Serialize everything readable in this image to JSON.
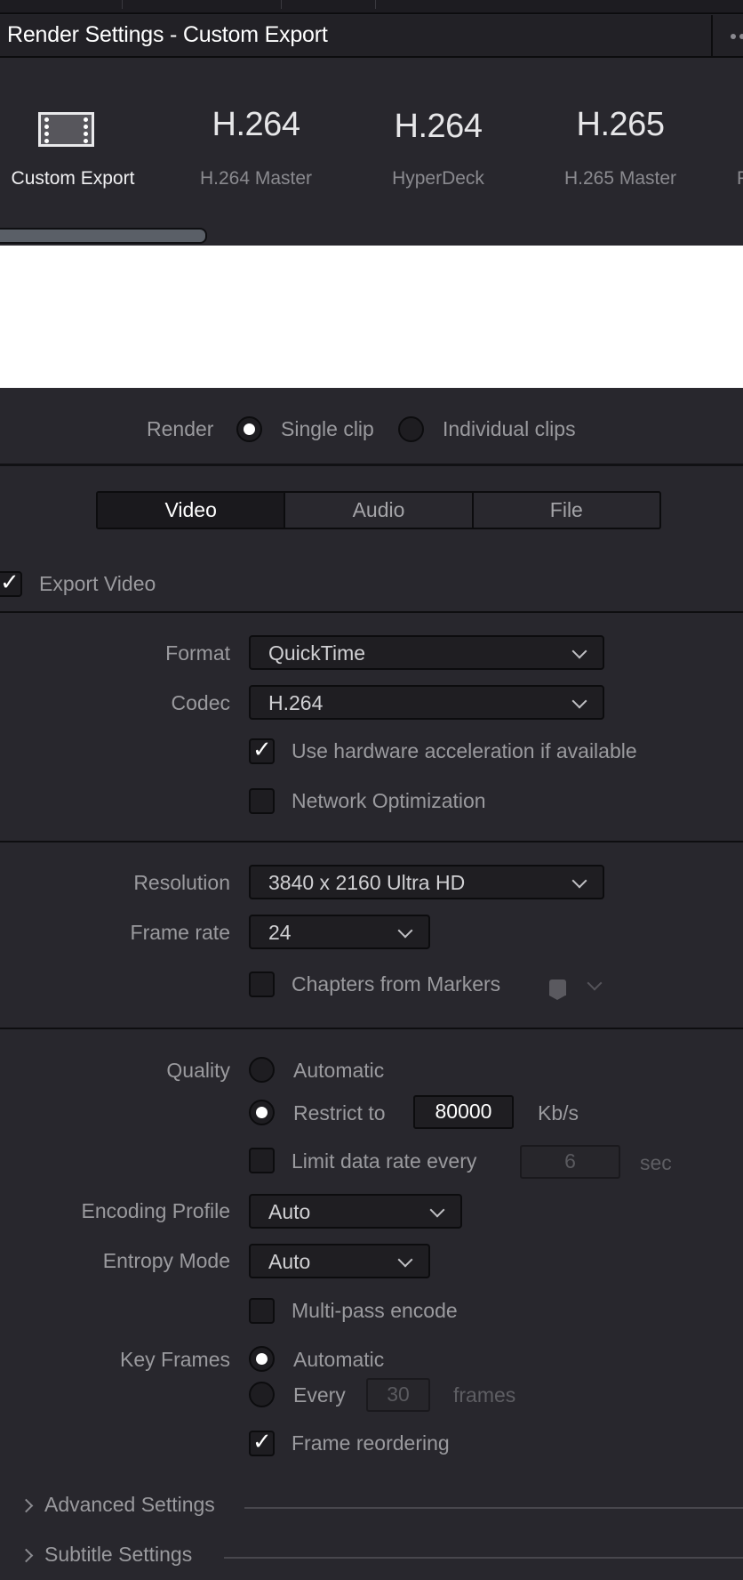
{
  "window": {
    "title": "Render Settings - Custom Export",
    "menu_icon": "more-dots-icon"
  },
  "presets": {
    "items": [
      {
        "id": "custom-export",
        "badge": "",
        "icon": "film-strip-icon",
        "label": "Custom Export",
        "active": true
      },
      {
        "id": "h264-master",
        "badge": "H.264",
        "label": "H.264 Master",
        "active": false
      },
      {
        "id": "hyperdeck",
        "badge": "H.264",
        "label": "HyperDeck",
        "active": false
      },
      {
        "id": "h265-master",
        "badge": "H.265",
        "label": "H.265 Master",
        "active": false
      },
      {
        "id": "partial",
        "badge": "",
        "label": "P",
        "active": false
      }
    ]
  },
  "render": {
    "label": "Render",
    "options": [
      {
        "label": "Single clip",
        "selected": true
      },
      {
        "label": "Individual clips",
        "selected": false
      }
    ]
  },
  "tabs": [
    {
      "label": "Video",
      "active": true
    },
    {
      "label": "Audio",
      "active": false
    },
    {
      "label": "File",
      "active": false
    }
  ],
  "video": {
    "export_video": {
      "label": "Export Video",
      "checked": true
    },
    "format": {
      "label": "Format",
      "value": "QuickTime"
    },
    "codec": {
      "label": "Codec",
      "value": "H.264"
    },
    "hardware_accel": {
      "label": "Use hardware acceleration if available",
      "checked": true
    },
    "network_opt": {
      "label": "Network Optimization",
      "checked": false
    },
    "resolution": {
      "label": "Resolution",
      "value": "3840 x 2160 Ultra HD"
    },
    "frame_rate": {
      "label": "Frame rate",
      "value": "24"
    },
    "chapters": {
      "label": "Chapters from Markers",
      "checked": false
    },
    "quality": {
      "label": "Quality",
      "automatic": {
        "label": "Automatic",
        "selected": false
      },
      "restrict": {
        "label": "Restrict to",
        "selected": true,
        "value": "80000",
        "unit": "Kb/s"
      },
      "limit_rate": {
        "label": "Limit data rate every",
        "checked": false,
        "value": "6",
        "unit": "sec"
      }
    },
    "encoding_profile": {
      "label": "Encoding Profile",
      "value": "Auto"
    },
    "entropy_mode": {
      "label": "Entropy Mode",
      "value": "Auto"
    },
    "multi_pass": {
      "label": "Multi-pass encode",
      "checked": false
    },
    "key_frames": {
      "label": "Key Frames",
      "automatic": {
        "label": "Automatic",
        "selected": true
      },
      "every": {
        "label": "Every",
        "selected": false,
        "value": "30",
        "unit": "frames"
      }
    },
    "frame_reordering": {
      "label": "Frame reordering",
      "checked": true
    }
  },
  "sections": [
    {
      "label": "Advanced Settings",
      "expanded": false
    },
    {
      "label": "Subtitle Settings",
      "expanded": false
    }
  ]
}
